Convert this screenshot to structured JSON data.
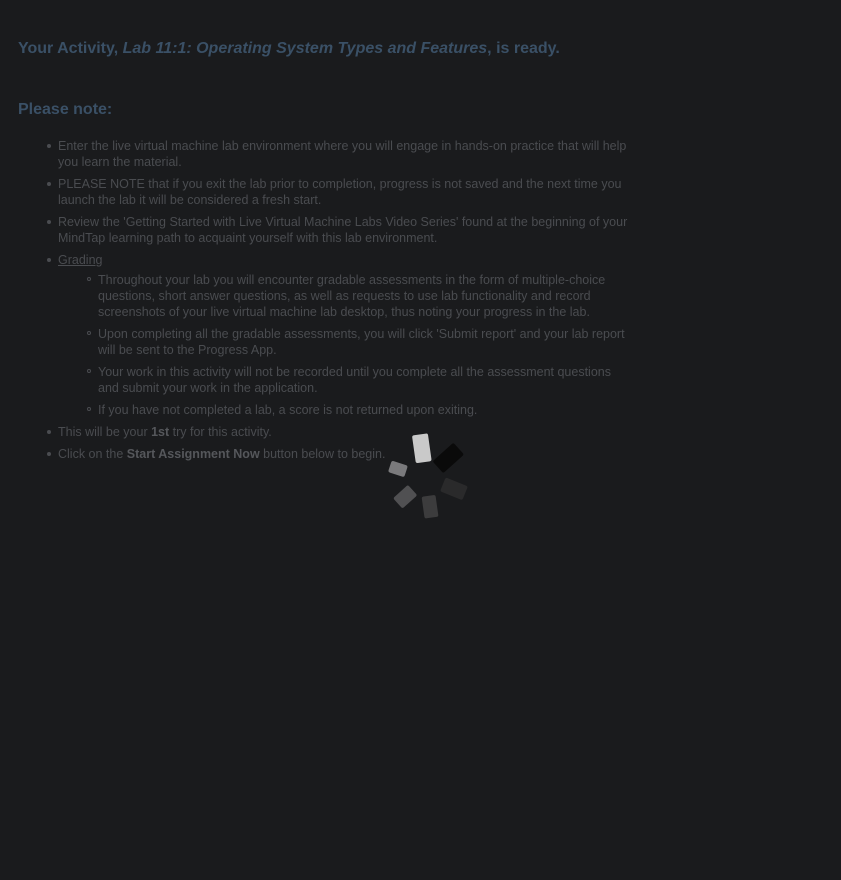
{
  "header": {
    "title_prefix": "Your Activity, ",
    "title_activity": "Lab 11:1: Operating System Types and Features",
    "title_suffix": ", is ready."
  },
  "note_heading": "Please note:",
  "items": {
    "enter": "Enter the live virtual machine lab environment where you will engage in hands-on practice that will help you learn the material.",
    "please_note": "PLEASE NOTE that if you exit the lab prior to completion, progress is not saved and the next time you launch the lab it will be considered a fresh start.",
    "review": "Review the 'Getting Started with Live Virtual Machine Labs Video Series' found at the beginning of your MindTap learning path to acquaint yourself with this lab environment.",
    "grading_label": "Grading",
    "grading_sub": [
      "Throughout your lab you will encounter gradable assessments in the form of multiple-choice questions, short answer questions, as well as requests to use lab functionality and record screenshots of your live virtual machine lab desktop, thus noting your progress in the lab.",
      "Upon completing all the gradable assessments, you will click 'Submit report' and your lab report will be sent to the Progress App.",
      "Your work in this activity will not be recorded until you complete all the assessment questions and submit your work in the application.",
      "If you have not completed a lab, a score is not returned upon exiting."
    ],
    "try_prefix": "This will be your ",
    "try_count": "1st",
    "try_suffix": " try for this activity.",
    "click_prefix": "Click on the ",
    "click_button_name": "Start Assignment Now",
    "click_suffix": " button below to begin."
  },
  "icons": {
    "spinner": "loading-spinner-icon"
  }
}
